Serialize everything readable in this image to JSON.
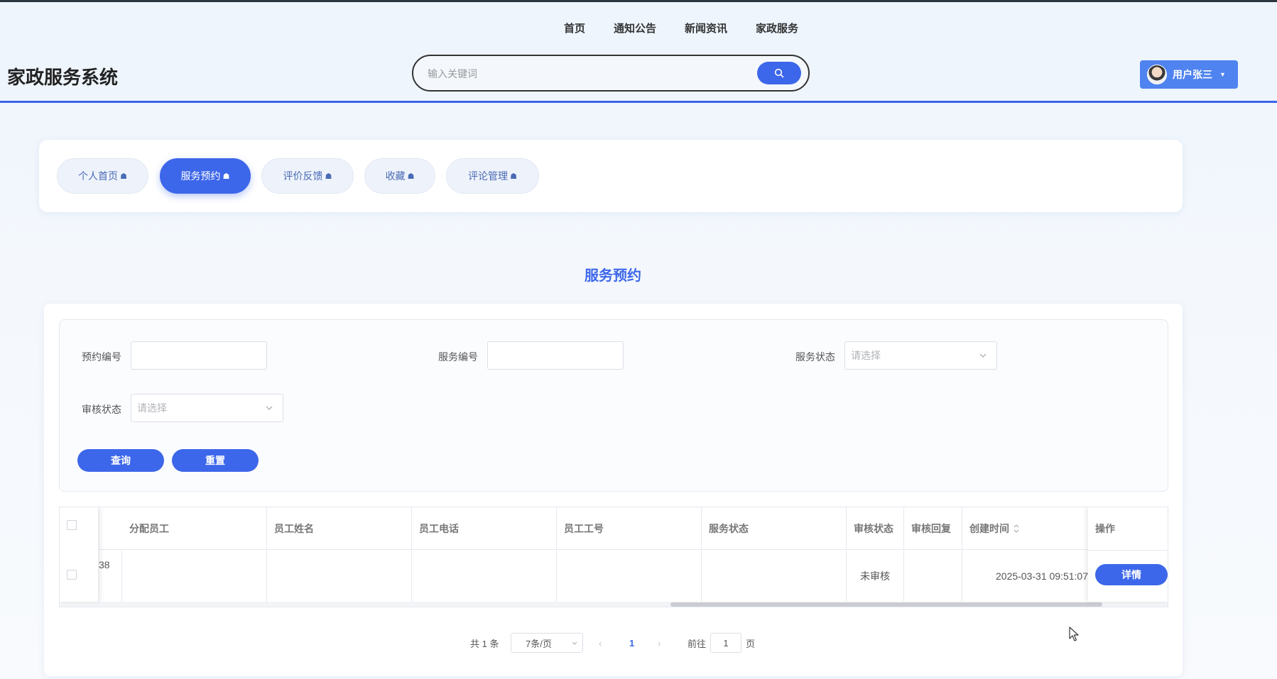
{
  "app": {
    "title": "家政服务系统"
  },
  "topnav": [
    "首页",
    "通知公告",
    "新闻资讯",
    "家政服务"
  ],
  "search": {
    "placeholder": "输入关键词",
    "icon": "search-icon"
  },
  "user": {
    "name": "用户张三",
    "menu_icon": "chevron-down-icon"
  },
  "tabs": [
    {
      "label": "个人首页",
      "active": false
    },
    {
      "label": "服务预约",
      "active": true
    },
    {
      "label": "评价反馈",
      "active": false
    },
    {
      "label": "收藏",
      "active": false
    },
    {
      "label": "评论管理",
      "active": false
    }
  ],
  "page_title": "服务预约",
  "filters": {
    "booking_no_label": "预约编号",
    "booking_no_value": "",
    "service_no_label": "服务编号",
    "service_no_value": "",
    "service_status_label": "服务状态",
    "service_status_placeholder": "请选择",
    "audit_status_label": "审核状态",
    "audit_status_placeholder": "请选择",
    "query_button": "查询",
    "reset_button": "重置"
  },
  "table": {
    "columns": [
      "分配员工",
      "员工姓名",
      "员工电话",
      "员工工号",
      "服务状态",
      "审核状态",
      "审核回复",
      "创建时间",
      "操作"
    ],
    "sort_icon": "sort-icon",
    "rows": [
      {
        "partial_id": "38",
        "assigned_staff": "",
        "staff_name": "",
        "staff_phone": "",
        "staff_no": "",
        "service_status": "",
        "audit_status": "未审核",
        "audit_reply": "",
        "created_at": "2025-03-31 09:51:07",
        "action": "详情"
      }
    ],
    "scroll_position": 0.66
  },
  "pagination": {
    "total_text": "共 1 条",
    "page_size": "7条/页",
    "current_page": "1",
    "goto_label": "前往",
    "goto_value": "1",
    "page_suffix": "页"
  },
  "colors": {
    "accent": "#3d67ea",
    "header_bg": "#eef5fd",
    "user_button": "#4f83f0"
  }
}
